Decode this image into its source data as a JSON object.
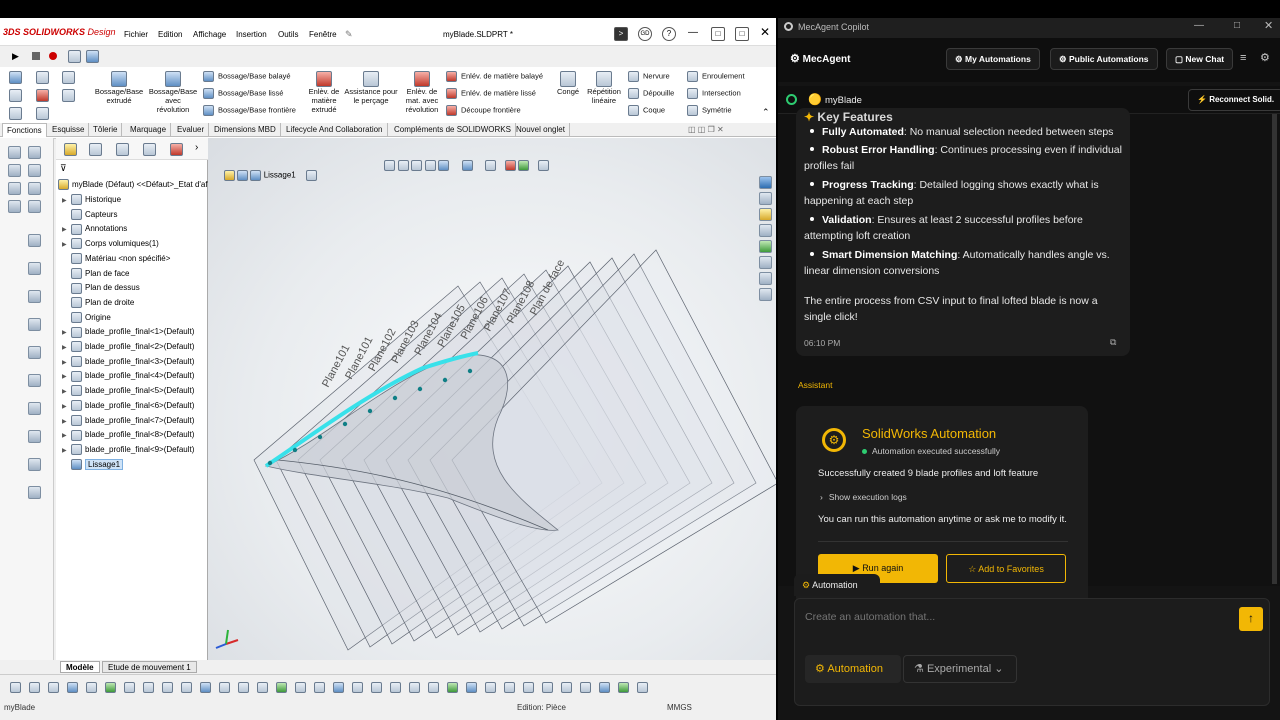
{
  "solidworks": {
    "logo": "3DS SOLIDWORKS",
    "logo_suffix": "Design",
    "menus": [
      "Fichier",
      "Edition",
      "Affichage",
      "Insertion",
      "Outils",
      "Fenêtre"
    ],
    "document_title": "myBlade.SLDPRT *",
    "ribbon": {
      "large_buttons": [
        {
          "label": "Bossage/Base\nextrudé"
        },
        {
          "label": "Bossage/Base\navec\nrévolution"
        },
        {
          "label": "Enlèv. de\nmatière\nextrudé"
        },
        {
          "label": "Assistance pour\nle perçage"
        },
        {
          "label": "Enlèv. de\nmat. avec\nrévolution"
        },
        {
          "label": "Congé"
        },
        {
          "label": "Répétition\nlinéaire"
        }
      ],
      "small_buttons": [
        "Bossage/Base balayé",
        "Bossage/Base lissé",
        "Bossage/Base frontière",
        "Enlév. de matière balayé",
        "Enlév. de matière lissé",
        "Découpe frontière",
        "Nervure",
        "Dépouille",
        "Coque",
        "Enroulement",
        "Intersection",
        "Symétrie"
      ]
    },
    "command_tabs": [
      "Fonctions",
      "Esquisse",
      "Tôlerie",
      "Marquage",
      "Evaluer",
      "Dimensions MBD",
      "Lifecycle And Collaboration",
      "Compléments de SOLIDWORKS",
      "Nouvel onglet"
    ],
    "active_command_tab": "Fonctions",
    "tree": {
      "root": "myBlade (Défaut) <<Défaut>_Etat d'af",
      "items": [
        {
          "label": "Historique",
          "expandable": true
        },
        {
          "label": "Capteurs",
          "expandable": false
        },
        {
          "label": "Annotations",
          "expandable": true
        },
        {
          "label": "Corps volumiques(1)",
          "expandable": true
        },
        {
          "label": "Matériau <non spécifié>",
          "expandable": false
        },
        {
          "label": "Plan de face",
          "expandable": false
        },
        {
          "label": "Plan de dessus",
          "expandable": false
        },
        {
          "label": "Plan de droite",
          "expandable": false
        },
        {
          "label": "Origine",
          "expandable": false
        },
        {
          "label": "blade_profile_final<1>(Default)",
          "expandable": true
        },
        {
          "label": "blade_profile_final<2>(Default)",
          "expandable": true
        },
        {
          "label": "blade_profile_final<3>(Default)",
          "expandable": true
        },
        {
          "label": "blade_profile_final<4>(Default)",
          "expandable": true
        },
        {
          "label": "blade_profile_final<5>(Default)",
          "expandable": true
        },
        {
          "label": "blade_profile_final<6>(Default)",
          "expandable": true
        },
        {
          "label": "blade_profile_final<7>(Default)",
          "expandable": true
        },
        {
          "label": "blade_profile_final<8>(Default)",
          "expandable": true
        },
        {
          "label": "blade_profile_final<9>(Default)",
          "expandable": true
        },
        {
          "label": "Lissage1",
          "expandable": false,
          "selected": true
        }
      ]
    },
    "breadcrumb_feature": "Lissage1",
    "plane_labels": [
      "Plane101",
      "Plane101",
      "Plane102",
      "Plane103",
      "Plane104",
      "Plane105",
      "Plane106",
      "Plane107",
      "Plane108",
      "Plan de face"
    ],
    "model_tabs": [
      "Modèle",
      "Etude de mouvement 1"
    ],
    "active_model_tab": "Modèle",
    "status": {
      "left": "myBlade",
      "middle": "Edition: Pièce",
      "right": "MMGS"
    }
  },
  "mecagent": {
    "window_title": "MecAgent Copilot",
    "brand": "MecAgent",
    "header_buttons": [
      "My Automations",
      "Public Automations",
      "New Chat"
    ],
    "project_name": "myBlade",
    "reconnect_label": "Reconnect Solid.",
    "message1": {
      "heading": "Key Features",
      "bullets": [
        {
          "bold": "Fully Automated",
          "text": ": No manual selection needed between steps"
        },
        {
          "bold": "Robust Error Handling",
          "text": ": Continues processing even if individual profiles fail"
        },
        {
          "bold": "Progress Tracking",
          "text": ": Detailed logging shows exactly what is happening at each step"
        },
        {
          "bold": "Validation",
          "text": ": Ensures at least 2 successful profiles before attempting loft creation"
        },
        {
          "bold": "Smart Dimension Matching",
          "text": ": Automatically handles angle vs. linear dimension conversions"
        }
      ],
      "summary": "The entire process from CSV input to final lofted blade is now a single click!",
      "time": "06:10 PM"
    },
    "assistant_label": "Assistant",
    "message2": {
      "title": "SolidWorks Automation",
      "status": "Automation executed successfully",
      "result": "Successfully created 9 blade profiles and loft feature",
      "logs_toggle": "Show execution logs",
      "note": "You can run this automation anytime or ask me to modify it.",
      "run_again": "Run again",
      "add_favorites": "Add to Favorites"
    },
    "mode_chip": "Automation",
    "input_placeholder": "Create an automation that...",
    "mode_buttons": [
      "Automation",
      "Experimental"
    ],
    "accent_color": "#f2b705",
    "success_color": "#2ecc71"
  }
}
